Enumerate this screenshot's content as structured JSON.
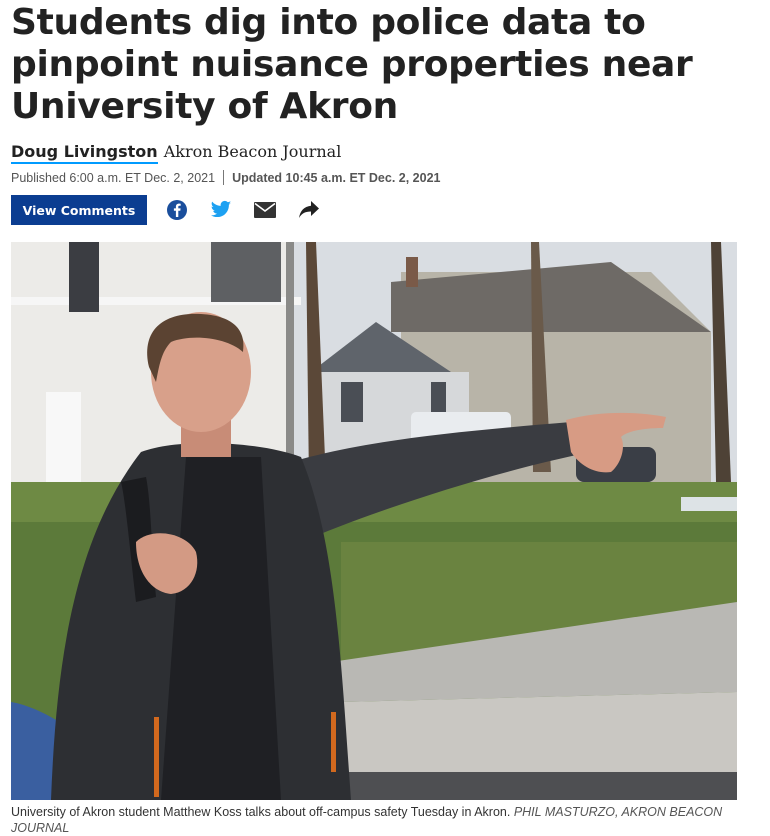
{
  "article": {
    "headline_lines": [
      "Students dig into police data to",
      "pinpoint nuisance properties near",
      "University of Akron"
    ],
    "author": "Doug Livingston",
    "publication": "Akron Beacon Journal",
    "published": "Published 6:00 a.m. ET Dec. 2, 2021",
    "updated": "Updated 10:45 a.m. ET Dec. 2, 2021"
  },
  "actions": {
    "view_comments_label": "View Comments",
    "share_icons": [
      "facebook-icon",
      "twitter-icon",
      "email-icon",
      "share-arrow-icon"
    ]
  },
  "photo": {
    "caption": "University of Akron student Matthew Koss talks about off-campus safety Tuesday in Akron.",
    "credit": "PHIL MASTURZO, AKRON BEACON JOURNAL"
  },
  "colors": {
    "button_bg": "#0b3d91",
    "author_underline": "#009bff",
    "facebook": "#1a4e9c",
    "twitter": "#1da1f2",
    "icon_dark": "#333333"
  }
}
